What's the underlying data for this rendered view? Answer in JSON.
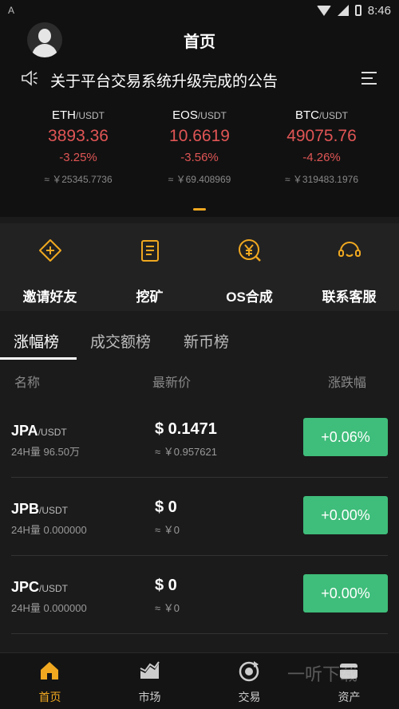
{
  "status_bar": {
    "left_indicator": "A",
    "time": "8:46"
  },
  "header": {
    "title": "首页",
    "avatar_icon": "user-avatar-icon"
  },
  "notice": {
    "icon": "speaker-icon",
    "text": "关于平台交易系统升级完成的公告",
    "menu_icon": "menu-icon"
  },
  "tickers": [
    {
      "base": "ETH",
      "quote": "/USDT",
      "price": "3893.36",
      "change": "-3.25%",
      "cny": "≈ ￥25345.7736"
    },
    {
      "base": "EOS",
      "quote": "/USDT",
      "price": "10.6619",
      "change": "-3.56%",
      "cny": "≈ ￥69.408969"
    },
    {
      "base": "BTC",
      "quote": "/USDT",
      "price": "49075.76",
      "change": "-4.26%",
      "cny": "≈ ￥319483.1976"
    }
  ],
  "quick_actions": [
    {
      "label": "邀请好友",
      "icon": "invite-icon"
    },
    {
      "label": "挖矿",
      "icon": "mining-icon"
    },
    {
      "label": "OS合成",
      "icon": "synthesis-icon"
    },
    {
      "label": "联系客服",
      "icon": "support-icon"
    }
  ],
  "tabs": [
    {
      "label": "涨幅榜",
      "active": true
    },
    {
      "label": "成交额榜",
      "active": false
    },
    {
      "label": "新币榜",
      "active": false
    }
  ],
  "columns": {
    "name": "名称",
    "price": "最新价",
    "change": "涨跌幅"
  },
  "market_rows": [
    {
      "base": "JPA",
      "quote": "/USDT",
      "volume": "24H量  96.50万",
      "price": "$ 0.1471",
      "cny": "≈ ￥0.957621",
      "change": "+0.06%"
    },
    {
      "base": "JPB",
      "quote": "/USDT",
      "volume": "24H量  0.000000",
      "price": "$ 0",
      "cny": "≈ ￥0",
      "change": "+0.00%"
    },
    {
      "base": "JPC",
      "quote": "/USDT",
      "volume": "24H量  0.000000",
      "price": "$ 0",
      "cny": "≈ ￥0",
      "change": "+0.00%"
    }
  ],
  "bottom_nav": [
    {
      "label": "首页",
      "icon": "home-icon",
      "active": true
    },
    {
      "label": "市场",
      "icon": "market-chart-icon",
      "active": false
    },
    {
      "label": "交易",
      "icon": "trade-icon",
      "active": false
    },
    {
      "label": "资产",
      "icon": "wallet-icon",
      "active": false
    }
  ],
  "watermark": "一听下载",
  "colors": {
    "accent": "#f0a820",
    "down": "#e05555",
    "up": "#3fbd7a"
  }
}
